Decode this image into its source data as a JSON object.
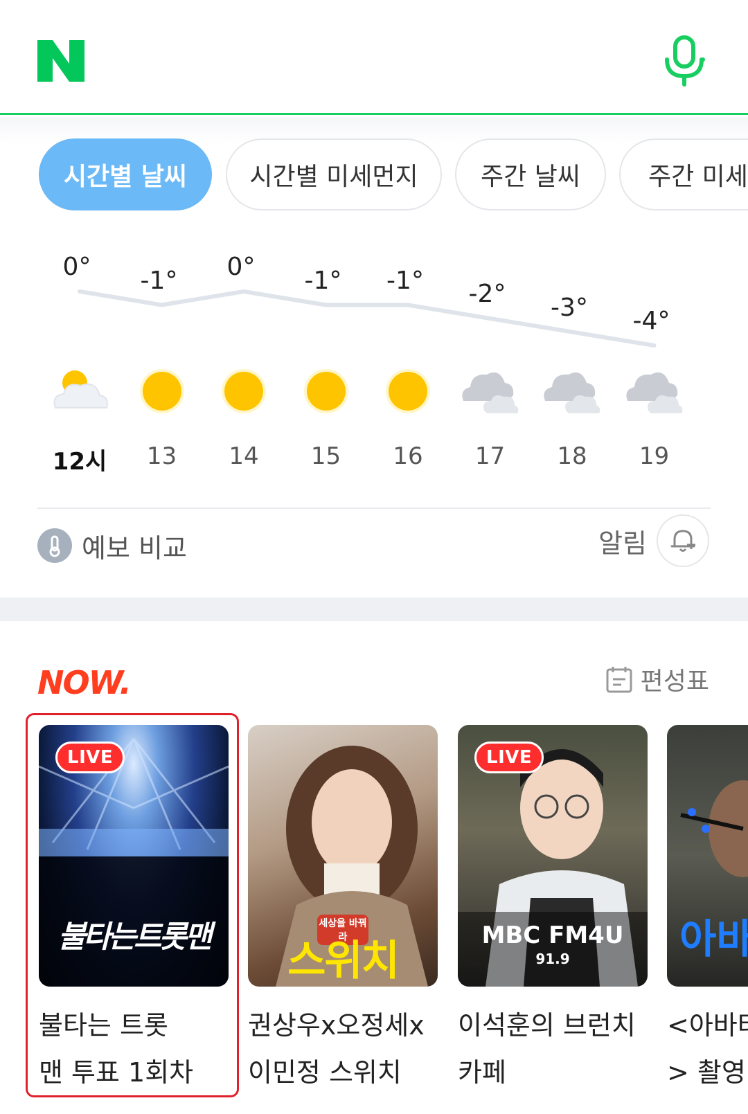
{
  "header": {
    "logo_text": "N",
    "logo_color": "#03c75a",
    "mic_icon": "microphone-icon"
  },
  "weather": {
    "tabs": [
      {
        "label": "시간별 날씨",
        "active": true
      },
      {
        "label": "시간별 미세먼지",
        "active": false
      },
      {
        "label": "주간 날씨",
        "active": false
      },
      {
        "label": "주간 미세먼",
        "active": false
      }
    ],
    "hourly": [
      {
        "temp": "0°",
        "hour": "12시",
        "icon": "sun-behind-cloud-icon"
      },
      {
        "temp": "-1°",
        "hour": "13",
        "icon": "sun-icon"
      },
      {
        "temp": "0°",
        "hour": "14",
        "icon": "sun-icon"
      },
      {
        "temp": "-1°",
        "hour": "15",
        "icon": "sun-icon"
      },
      {
        "temp": "-1°",
        "hour": "16",
        "icon": "sun-icon"
      },
      {
        "temp": "-2°",
        "hour": "17",
        "icon": "cloudy-icon"
      },
      {
        "temp": "-3°",
        "hour": "18",
        "icon": "cloudy-icon"
      },
      {
        "temp": "-4°",
        "hour": "19",
        "icon": "cloudy-icon"
      }
    ],
    "compare_label": "예보 비교",
    "alarm_label": "알림"
  },
  "now": {
    "logo_text": "NOW.",
    "schedule_label": "편성표",
    "cards": [
      {
        "title": "불타는 트롯맨 투표 1회차",
        "title_line1": "불타는 트롯",
        "title_line2": "맨 투표 1회차",
        "live": true,
        "badge": "LIVE",
        "thumb_text": "불타는트롯맨"
      },
      {
        "title": "권상우x오정세x이민정 스위치",
        "title_line1": "권상우x오정세x",
        "title_line2": "이민정 스위치",
        "live": false,
        "thumb_text": "스위치",
        "thumb_sub": "세상을 바꿔라"
      },
      {
        "title": "이석훈의 브런치카페",
        "title_line1": "이석훈의 브런치",
        "title_line2": "카페",
        "live": true,
        "badge": "LIVE",
        "thumb_text": "MBC FM4U",
        "thumb_sub": "91.9"
      },
      {
        "title": "<아바타> 촬영",
        "title_line1": "<아바타",
        "title_line2": "> 촬영",
        "live": false,
        "thumb_text": "아바"
      }
    ]
  }
}
